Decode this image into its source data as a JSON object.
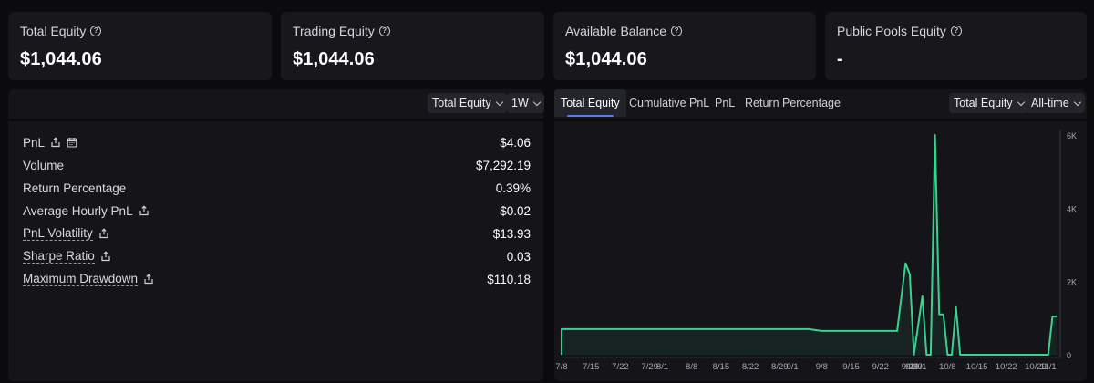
{
  "cards": [
    {
      "label": "Total Equity",
      "value": "$1,044.06"
    },
    {
      "label": "Trading Equity",
      "value": "$1,044.06"
    },
    {
      "label": "Available Balance",
      "value": "$1,044.06"
    },
    {
      "label": "Public Pools Equity",
      "value": "-"
    }
  ],
  "left_panel": {
    "metric_select": "Total Equity",
    "period_select": "1W",
    "stats": [
      {
        "label": "PnL",
        "value": "$4.06",
        "icons": [
          "share-icon",
          "calendar-icon"
        ]
      },
      {
        "label": "Volume",
        "value": "$7,292.19"
      },
      {
        "label": "Return Percentage",
        "value": "0.39%"
      },
      {
        "label": "Average Hourly PnL",
        "value": "$0.02",
        "icons": [
          "share-icon"
        ]
      },
      {
        "label": "PnL Volatility",
        "value": "$13.93",
        "icons": [
          "share-icon"
        ]
      },
      {
        "label": "Sharpe Ratio",
        "value": "0.03",
        "icons": [
          "share-icon"
        ]
      },
      {
        "label": "Maximum Drawdown",
        "value": "$110.18",
        "icons": [
          "share-icon"
        ]
      }
    ]
  },
  "right_panel": {
    "tabs": [
      "Total Equity",
      "Cumulative PnL",
      "PnL",
      "Return Percentage"
    ],
    "active_tab": "Total Equity",
    "metric_select": "Total Equity",
    "range_select": "All-time"
  },
  "colors": {
    "line": "#3ecf8e",
    "accent": "#5b7cf0"
  },
  "chart_data": {
    "type": "line",
    "title": "",
    "xlabel": "",
    "ylabel": "",
    "x_ticks": [
      "7/8",
      "7/15",
      "7/22",
      "7/29",
      "8/1",
      "8/8",
      "8/15",
      "8/22",
      "8/29",
      "9/1",
      "9/8",
      "9/15",
      "9/22",
      "9/29",
      "9/30",
      "10/1",
      "10/8",
      "10/15",
      "10/22",
      "10/29",
      "11/1"
    ],
    "y_ticks": [
      "0",
      "2K",
      "4K",
      "6K"
    ],
    "ylim": [
      0,
      6000
    ],
    "grid": false,
    "series": [
      {
        "x": [
          "7/8",
          "7/8",
          "9/5",
          "9/8",
          "9/26",
          "9/28",
          "9/29",
          "9/30",
          "10/2",
          "10/3",
          "10/4",
          "10/5",
          "10/6",
          "10/7",
          "10/8",
          "10/9",
          "10/10",
          "10/11",
          "10/12",
          "10/13",
          "10/14",
          "10/15",
          "10/16",
          "10/22",
          "10/29",
          "11/1",
          "11/2",
          "11/3"
        ],
        "values": [
          0,
          700,
          700,
          650,
          650,
          2500,
          2200,
          0,
          1600,
          0,
          0,
          6000,
          1100,
          1100,
          0,
          0,
          1300,
          0,
          0,
          0,
          0,
          0,
          0,
          0,
          0,
          0,
          1044,
          1044
        ]
      }
    ]
  }
}
